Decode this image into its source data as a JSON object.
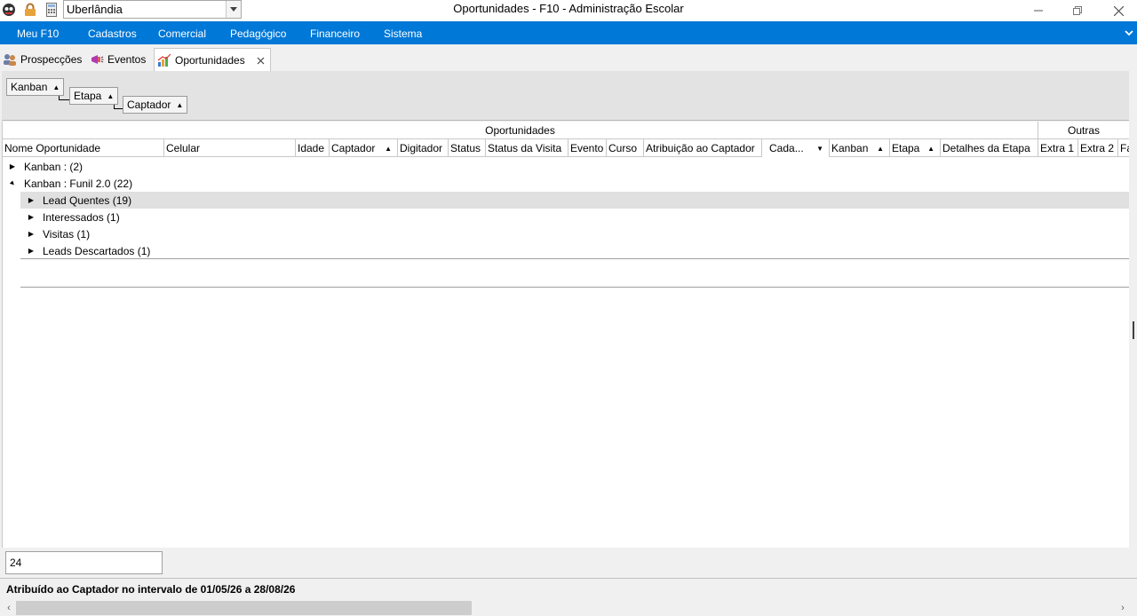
{
  "titlebar": {
    "title": "Oportunidades - F10 - Administração Escolar",
    "unit_select": "Uberlândia"
  },
  "menu": {
    "items": [
      "Meu F10",
      "Cadastros",
      "Comercial",
      "Pedagógico",
      "Financeiro",
      "Sistema"
    ]
  },
  "tabs": [
    {
      "label": "Prospecções"
    },
    {
      "label": "Eventos"
    },
    {
      "label": "Oportunidades"
    }
  ],
  "group_panel": {
    "items": [
      "Kanban",
      "Etapa",
      "Captador"
    ]
  },
  "grid": {
    "bands": {
      "main": "Oportunidades",
      "other": "Outras"
    },
    "columns": [
      "Nome Oportunidade",
      "Celular",
      "Idade",
      "Captador",
      "Digitador",
      "Status",
      "Status da Visita",
      "Evento",
      "Curso",
      "Atribuição ao Captador",
      "Cada...",
      "Kanban",
      "Etapa",
      "Detalhes da Etapa",
      "Extra 1",
      "Extra 2",
      "Fa"
    ],
    "rows": [
      {
        "label": "Kanban :  (2)"
      },
      {
        "label": "Kanban : Funil 2.0 (22)"
      },
      {
        "label": "Lead Quentes (19)"
      },
      {
        "label": "Interessados (1)"
      },
      {
        "label": "Visitas (1)"
      },
      {
        "label": "Leads Descartados (1)"
      }
    ]
  },
  "footer": {
    "count": "24",
    "status": "Atribuído ao Captador no intervalo de 01/05/26 a 28/08/26"
  },
  "colors": {
    "menubar": "#0078d7",
    "highlight_row": "#e0e0e0"
  }
}
